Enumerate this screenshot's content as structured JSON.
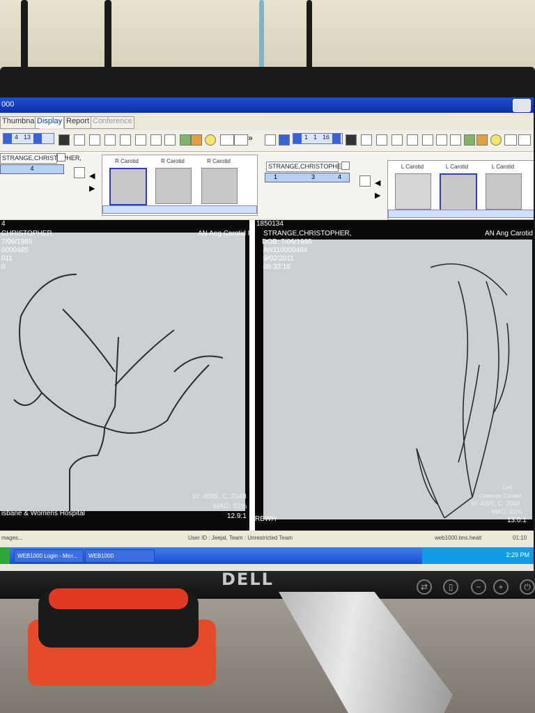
{
  "app": {
    "title": "000",
    "tabs": [
      "Thumbnail",
      "Display",
      "Report",
      "Conference"
    ]
  },
  "left_panel": {
    "patient_name": "STRANGE,CHRISTOPHER,",
    "slider_value": "4",
    "nav_numbers": [
      "4",
      "13"
    ],
    "thumbnails": [
      "R Carotid",
      "R Carotid",
      "R Carotid"
    ],
    "overlay": {
      "line1": "4",
      "line2": "CHRISTOPHER,",
      "line3": "7/06/1985",
      "line4": "0000485",
      "line5": "011",
      "line6": "0",
      "top_right": "AN Ang Carotid R",
      "wl": "W: 4095, C: 2048",
      "mag": "MAG: 61%",
      "ratio": "12.9:1",
      "institution": "isbane & Womens Hospital"
    }
  },
  "right_panel": {
    "patient_name": "STRANGE,CHRISTOPHER,",
    "nav_numbers": [
      "1",
      "1",
      "16"
    ],
    "slider_values": [
      "1",
      "3",
      "4"
    ],
    "thumbnails": [
      "L Carotid",
      "L Carotid",
      "L Carotid"
    ],
    "overlay": {
      "id": "1850134",
      "name": "STRANGE,CHRISTOPHER,",
      "dob": "DOB: 7/06/1985",
      "an": "AN110000484",
      "date": "9/02/2011",
      "time": "09:33:18",
      "top_right": "AN Ang Carotid",
      "side": "Left",
      "vessel": "Common Carotid",
      "wl": "W: 4095, C: 2048",
      "mag": "MAG: 61%",
      "ratio": "13.0:1",
      "institution": "RBWH"
    }
  },
  "status_bar": {
    "left": "mages...",
    "user": "User ID : Jeejal, Team : Unrestricted Team",
    "right": "web1000.bns.healt",
    "right_time": "01:10"
  },
  "taskbar": {
    "items": [
      "WEB1000 Login - Micr...",
      "WEB1000"
    ],
    "clock": "2:29 PM"
  },
  "monitor": {
    "brand": "DELL"
  }
}
